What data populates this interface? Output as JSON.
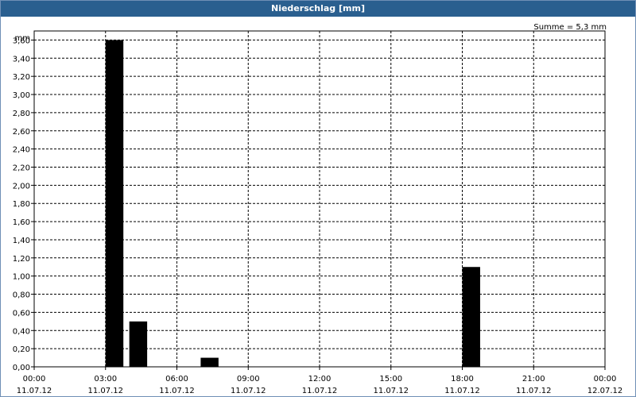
{
  "window": {
    "title": "Niederschlag [mm]"
  },
  "chart_data": {
    "type": "bar",
    "title": "Niederschlag [mm]",
    "ylabel": "mm",
    "summary": "Summe = 5,3 mm",
    "ylim": [
      0,
      3.7
    ],
    "yticks": [
      "0,00",
      "0,20",
      "0,40",
      "0,60",
      "0,80",
      "1,00",
      "1,20",
      "1,40",
      "1,60",
      "1,80",
      "2,00",
      "2,20",
      "2,40",
      "2,60",
      "2,80",
      "3,00",
      "3,20",
      "3,40",
      "3,60"
    ],
    "xlim_hours": [
      0,
      24
    ],
    "xticks": [
      {
        "time": "00:00",
        "date": "11.07.12"
      },
      {
        "time": "03:00",
        "date": "11.07.12"
      },
      {
        "time": "06:00",
        "date": "11.07.12"
      },
      {
        "time": "09:00",
        "date": "11.07.12"
      },
      {
        "time": "12:00",
        "date": "11.07.12"
      },
      {
        "time": "15:00",
        "date": "11.07.12"
      },
      {
        "time": "18:00",
        "date": "11.07.12"
      },
      {
        "time": "21:00",
        "date": "11.07.12"
      },
      {
        "time": "00:00",
        "date": "12.07.12"
      }
    ],
    "bars": [
      {
        "start": "03:00",
        "end": "03:45",
        "value": 3.6
      },
      {
        "start": "04:00",
        "end": "04:45",
        "value": 0.5
      },
      {
        "start": "07:00",
        "end": "07:45",
        "value": 0.1
      },
      {
        "start": "18:00",
        "end": "18:45",
        "value": 1.1
      }
    ],
    "grid": true,
    "bar_color": "#000000"
  }
}
